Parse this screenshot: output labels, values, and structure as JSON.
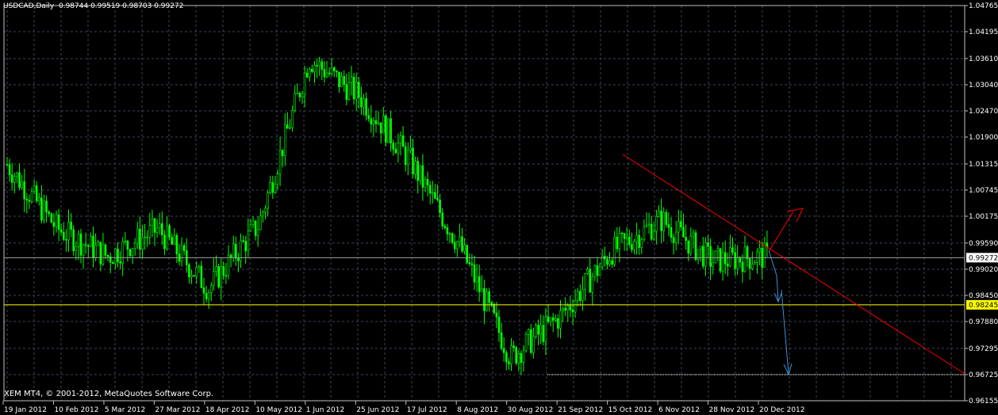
{
  "header": {
    "symbol_label": "USDCAD,Daily",
    "ohlc_values": "0.98744 0.99519 0.98703 0.99272"
  },
  "footer": {
    "copyright": "XEM MT4, © 2001-2012, MetaQuotes Software Corp."
  },
  "colors": {
    "background": "#000000",
    "grid": "#3a4658",
    "axis": "#c0c0c0",
    "candle": "#00ff00",
    "support_line": "#ffff00",
    "bid_line": "#a0a0a0",
    "trendline": "#ff0000",
    "up_arrow": "#ff0000",
    "down_arrow": "#3a8fd8",
    "target_line": "#ffffff"
  },
  "chart_data": {
    "type": "candlestick",
    "instrument": "USDCAD",
    "timeframe": "Daily",
    "ylim": [
      0.96155,
      1.04765
    ],
    "y_ticks": [
      "1.04765",
      "1.04195",
      "1.03610",
      "1.03040",
      "1.02470",
      "1.01900",
      "1.01315",
      "1.00745",
      "1.00175",
      "0.99590",
      "0.99020",
      "0.98450",
      "0.97880",
      "0.97295",
      "0.96725",
      "0.96155"
    ],
    "x_ticks": [
      "19 Jan 2012",
      "10 Feb 2012",
      "5 Mar 2012",
      "27 Mar 2012",
      "18 Apr 2012",
      "10 May 2012",
      "1 Jun 2012",
      "25 Jun 2012",
      "17 Jul 2012",
      "8 Aug 2012",
      "30 Aug 2012",
      "21 Sep 2012",
      "15 Oct 2012",
      "6 Nov 2012",
      "28 Nov 2012",
      "20 Dec 2012"
    ],
    "current_price_label": "0.99272",
    "current_price": 0.99272,
    "support_price_label": "0.98245",
    "support_price": 0.98245,
    "target_price": 0.96725,
    "approx_close_path": [
      [
        "19 Jan 2012",
        1.013
      ],
      [
        "10 Feb 2012",
        0.999
      ],
      [
        "5 Mar 2012",
        0.993
      ],
      [
        "27 Mar 2012",
        0.999
      ],
      [
        "18 Apr 2012",
        0.986
      ],
      [
        "10 May 2012",
        1.0
      ],
      [
        "1 Jun 2012",
        1.036
      ],
      [
        "25 Jun 2012",
        1.028
      ],
      [
        "17 Jul 2012",
        1.014
      ],
      [
        "8 Aug 2012",
        0.995
      ],
      [
        "30 Aug 2012",
        0.971
      ],
      [
        "21 Sep 2012",
        0.98
      ],
      [
        "15 Oct 2012",
        0.994
      ],
      [
        "6 Nov 2012",
        1.001
      ],
      [
        "28 Nov 2012",
        0.992
      ],
      [
        "20 Dec 2012",
        0.993
      ]
    ]
  }
}
